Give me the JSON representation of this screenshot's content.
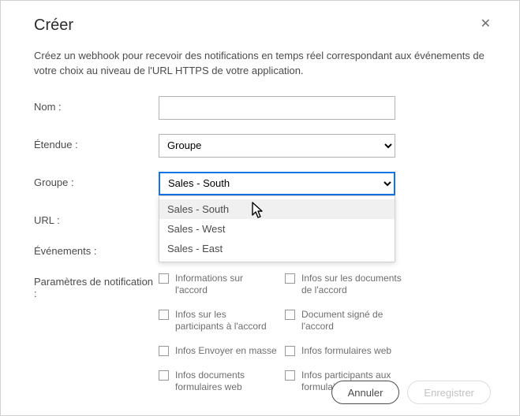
{
  "header": {
    "title": "Créer",
    "close_glyph": "✕"
  },
  "intro": "Créez un webhook pour recevoir des notifications en temps réel correspondant aux événements de votre choix au niveau de l'URL HTTPS de votre application.",
  "labels": {
    "name": "Nom :",
    "scope": "Étendue :",
    "group": "Groupe :",
    "url": "URL :",
    "events": "Événements :",
    "params": "Paramètres de notification :"
  },
  "fields": {
    "name_value": "",
    "scope_value": "Groupe",
    "group_value": "Sales - South",
    "url_value": ""
  },
  "group_options": [
    "Sales - South",
    "Sales - West",
    "Sales - East"
  ],
  "params": [
    {
      "label": "Informations sur l'accord"
    },
    {
      "label": "Infos sur les documents de l'accord"
    },
    {
      "label": "Infos sur les participants à l'accord"
    },
    {
      "label": "Document signé de l'accord"
    },
    {
      "label": "Infos Envoyer en masse"
    },
    {
      "label": "Infos formulaires web"
    },
    {
      "label": "Infos documents formulaires web"
    },
    {
      "label": "Infos participants aux formulaires web"
    }
  ],
  "buttons": {
    "cancel": "Annuler",
    "save": "Enregistrer"
  }
}
